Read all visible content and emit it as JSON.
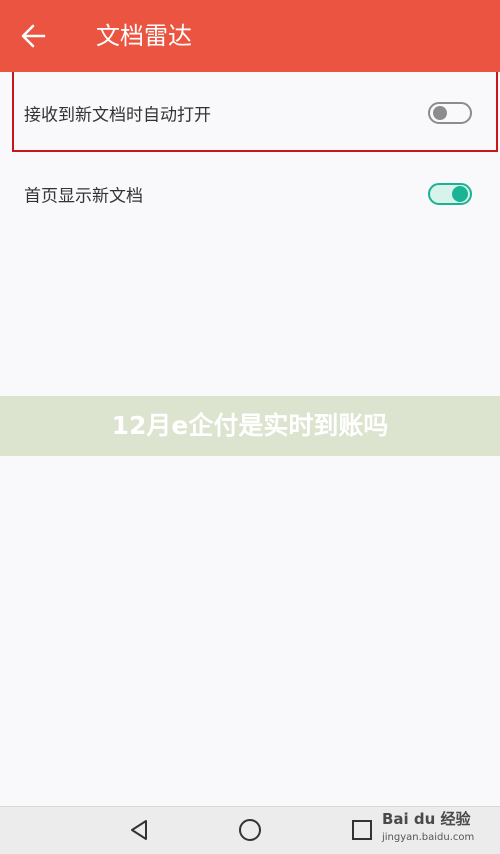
{
  "header": {
    "title": "文档雷达",
    "back_icon": "arrow-left-icon",
    "background": "#ea5440"
  },
  "settings": [
    {
      "label": "接收到新文档时自动打开",
      "enabled": false
    },
    {
      "label": "首页显示新文档",
      "enabled": true
    }
  ],
  "colors": {
    "toggle_on": "#1ab393",
    "toggle_off": "#8c8c8c",
    "highlight_frame": "#c8171b"
  },
  "overlay_banner": {
    "text": "12月e企付是实时到账吗"
  },
  "navbar": {
    "back_icon": "triangle-back-icon",
    "home_icon": "circle-home-icon",
    "recent_icon": "square-recent-icon"
  },
  "watermark": {
    "logo_text": "Bai du 经验",
    "url_text": "jingyan.baidu.com"
  }
}
